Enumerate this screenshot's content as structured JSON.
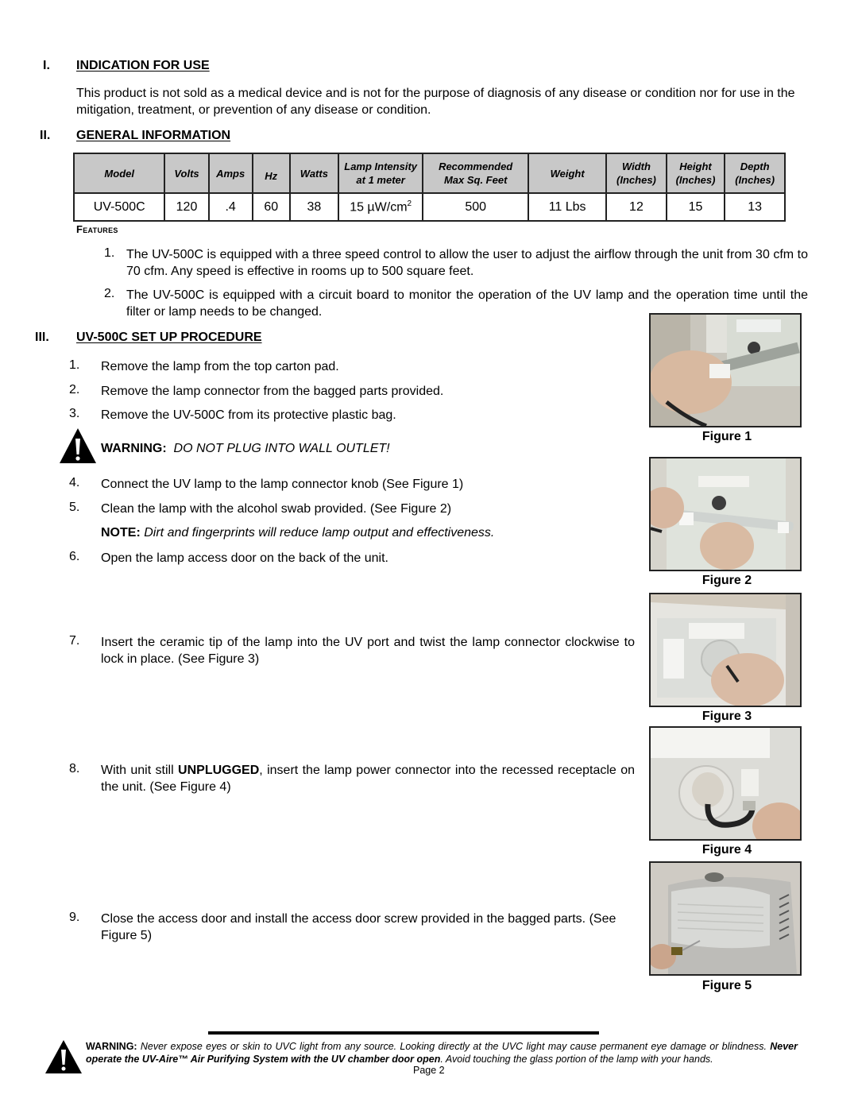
{
  "sections": {
    "indication": {
      "number": "I.",
      "title": "INDICATION FOR USE",
      "body": "This product is not sold as a medical device and is not for the purpose of diagnosis of any disease or condition nor for use in the mitigation, treatment, or prevention of any disease or condition."
    },
    "general": {
      "number": "II.",
      "title": "GENERAL INFORMATION",
      "table": {
        "headers": [
          "Model",
          "Volts",
          "Amps",
          "Hz",
          "Watts",
          "Lamp Intensity at 1 meter",
          "Recommended Max Sq. Feet",
          "Weight",
          "Width (Inches)",
          "Height (Inches)",
          "Depth (Inches)"
        ],
        "header_lines": [
          [
            "Model"
          ],
          [
            "Volts"
          ],
          [
            "Amps"
          ],
          [
            "Hz"
          ],
          [
            "Watts"
          ],
          [
            "Lamp Intensity",
            "at 1 meter"
          ],
          [
            "Recommended",
            "Max Sq. Feet"
          ],
          [
            "Weight"
          ],
          [
            "Width",
            "(Inches)"
          ],
          [
            "Height",
            "(Inches)"
          ],
          [
            "Depth",
            "(Inches)"
          ]
        ],
        "row": {
          "model": "UV-500C",
          "volts": "120",
          "amps": ".4",
          "hz": "60",
          "watts": "38",
          "lamp_intensity": "15 µW/cm",
          "lamp_intensity_sup": "2",
          "max_sq_feet": "500",
          "weight": "11 Lbs",
          "width": "12",
          "height": "15",
          "depth": "13"
        }
      },
      "features_label": "Features",
      "features": [
        {
          "n": "1.",
          "text": "The UV-500C is equipped with a three speed control to allow the user to adjust the airflow through the unit from 30 cfm to 70 cfm. Any speed is effective in rooms up to 500 square feet."
        },
        {
          "n": "2.",
          "text": "The UV-500C is equipped with a circuit board to monitor the operation of the UV lamp and the operation time until the filter or lamp needs to be changed."
        }
      ]
    },
    "setup": {
      "number": "III.",
      "title": "UV-500C SET UP PROCEDURE",
      "steps": [
        {
          "n": "1.",
          "text": "Remove the lamp from the top carton pad."
        },
        {
          "n": "2.",
          "text": "Remove the lamp connector from the bagged parts provided."
        },
        {
          "n": "3.",
          "text": "Remove the UV-500C from its protective plastic bag."
        },
        {
          "n": "4.",
          "text": "Connect the UV lamp to the lamp connector knob (See Figure 1)"
        },
        {
          "n": "5.",
          "text": "Clean the lamp with the alcohol swab provided. (See Figure 2)"
        },
        {
          "n": "6.",
          "text": "Open the lamp access door on the back of the unit."
        },
        {
          "n": "7.",
          "text": "Insert the ceramic tip of the lamp into the UV port and twist the lamp connector clockwise to lock in place. (See Figure 3)"
        },
        {
          "n": "8.",
          "pre": "With unit still ",
          "bold": "UNPLUGGED",
          "post": ", insert the lamp power connector into the recessed receptacle on the unit. (See Figure 4)"
        },
        {
          "n": "9.",
          "text": "Close the access door and install the access door screw provided in the bagged parts. (See Figure 5)"
        }
      ],
      "warning": {
        "label": "WARNING:",
        "text": "DO NOT PLUG INTO WALL OUTLET!"
      },
      "note": {
        "label": "NOTE:",
        "text": "Dirt and fingerprints will reduce lamp output and effectiveness."
      }
    }
  },
  "figures": [
    {
      "caption": "Figure 1",
      "alt": "Hands connecting UV lamp to lamp connector knob"
    },
    {
      "caption": "Figure 2",
      "alt": "Cleaning the lamp with alcohol swab"
    },
    {
      "caption": "Figure 3",
      "alt": "Inserting lamp into UV port"
    },
    {
      "caption": "Figure 4",
      "alt": "Lamp power connector inserted into receptacle"
    },
    {
      "caption": "Figure 5",
      "alt": "Installing access door screw"
    }
  ],
  "footer": {
    "warning_label": "WARNING:",
    "text1": " Never expose eyes or skin to UVC light from any source. Looking directly at the UVC light may cause permanent eye damage or blindness. ",
    "bold_text": "Never operate the UV-Aire™ Air Purifying System with the UV chamber door open",
    "text2": ". Avoid touching the glass portion of the lamp with your hands.",
    "page": "Page 2"
  }
}
